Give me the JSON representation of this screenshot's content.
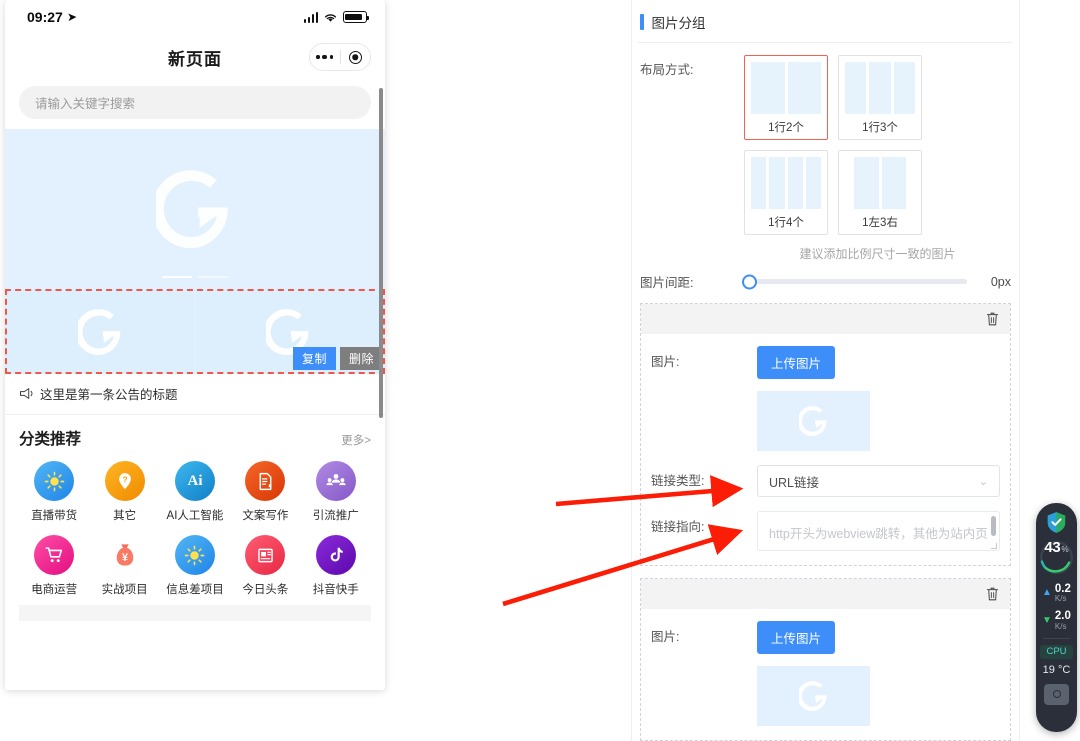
{
  "phone": {
    "status": {
      "time": "09:27",
      "location_icon": "location-arrow-icon"
    },
    "nav": {
      "title": "新页面"
    },
    "search": {
      "placeholder": "请输入关键字搜索"
    },
    "banner": {
      "logo": "g-logo-icon"
    },
    "selection": {
      "copy_label": "复制",
      "delete_label": "删除"
    },
    "notice": {
      "icon": "megaphone-icon",
      "text": "这里是第一条公告的标题"
    },
    "category": {
      "title": "分类推荐",
      "more_label": "更多>",
      "items": [
        {
          "label": "直播带货",
          "icon": "sun-icon",
          "color": "#2e9bf0"
        },
        {
          "label": "其它",
          "icon": "question-pin-icon",
          "color": "#f79c09"
        },
        {
          "label": "AI人工智能",
          "icon": "ai-icon",
          "color": "#1993d8"
        },
        {
          "label": "文案写作",
          "icon": "document-edit-icon",
          "color": "#e8450c"
        },
        {
          "label": "引流推广",
          "icon": "people-group-icon",
          "color": "#9b74d6"
        },
        {
          "label": "电商运营",
          "icon": "shopping-cart-icon",
          "color": "#f0268f"
        },
        {
          "label": "实战项目",
          "icon": "money-bag-icon",
          "color": "#fa6a5a"
        },
        {
          "label": "信息差项目",
          "icon": "sun-icon",
          "color": "#2e9bf0"
        },
        {
          "label": "今日头条",
          "icon": "news-icon",
          "color": "#f2405a"
        },
        {
          "label": "抖音快手",
          "icon": "tiktok-note-icon",
          "color": "#6b17c9"
        }
      ]
    }
  },
  "panel": {
    "title": "图片分组",
    "layout": {
      "label": "布局方式:",
      "options": [
        {
          "caption": "1行2个",
          "cells": 2,
          "selected": true
        },
        {
          "caption": "1行3个",
          "cells": 3,
          "selected": false
        },
        {
          "caption": "1行4个",
          "cells": 4,
          "selected": false
        },
        {
          "caption": "1左3右",
          "cells": 0,
          "selected": false
        }
      ],
      "hint": "建议添加比例尺寸一致的图片"
    },
    "spacing": {
      "label": "图片间距:",
      "value": "0px",
      "percent": 0
    },
    "cards": [
      {
        "delete_icon": "trash-icon",
        "image_label": "图片:",
        "upload_label": "上传图片",
        "preview_icon": "g-logo-icon",
        "link_type_label": "链接类型:",
        "link_type_value": "URL链接",
        "link_target_label": "链接指向:",
        "link_target_placeholder": "http开头为webview跳转，其他为站内页"
      },
      {
        "delete_icon": "trash-icon",
        "image_label": "图片:",
        "upload_label": "上传图片",
        "preview_icon": "g-logo-icon"
      }
    ]
  },
  "widget": {
    "shield_icon": "shield-check-icon",
    "gauge_value": "43",
    "gauge_unit": "%",
    "upload": {
      "value": "0.2",
      "unit": "K/s",
      "arrow": "arrow-up-icon"
    },
    "download": {
      "value": "2.0",
      "unit": "K/s",
      "arrow": "arrow-down-icon"
    },
    "cpu_label": "CPU",
    "temperature": "19 °C",
    "camera_icon": "camera-icon"
  },
  "colors": {
    "accent": "#3d8ef8",
    "selected_border": "#f06352",
    "dashed_selection": "#f0574b",
    "placeholder_bg": "#e3f0fd"
  }
}
